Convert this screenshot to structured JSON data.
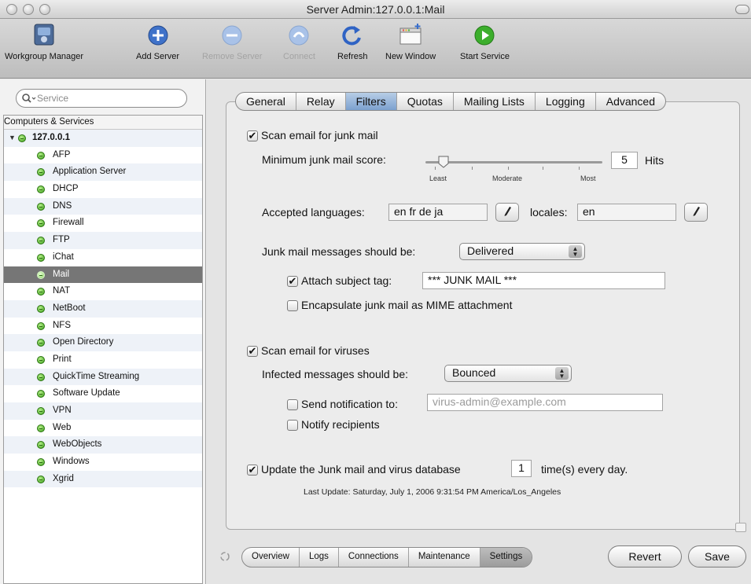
{
  "window": {
    "title": "Server Admin:127.0.0.1:Mail"
  },
  "toolbar": {
    "items": [
      {
        "label": "Workgroup Manager",
        "icon": "workgroup-manager-icon",
        "enabled": true
      },
      {
        "label": "Add Server",
        "icon": "add-server-icon",
        "enabled": true
      },
      {
        "label": "Remove Server",
        "icon": "remove-server-icon",
        "enabled": false
      },
      {
        "label": "Connect",
        "icon": "connect-icon",
        "enabled": false
      },
      {
        "label": "Refresh",
        "icon": "refresh-icon",
        "enabled": true
      },
      {
        "label": "New Window",
        "icon": "new-window-icon",
        "enabled": true
      },
      {
        "label": "Start Service",
        "icon": "start-service-icon",
        "enabled": true
      }
    ]
  },
  "sidebar": {
    "search_placeholder": "Service",
    "header": "Computers & Services",
    "server": "127.0.0.1",
    "services": [
      "AFP",
      "Application Server",
      "DHCP",
      "DNS",
      "Firewall",
      "FTP",
      "iChat",
      "Mail",
      "NAT",
      "NetBoot",
      "NFS",
      "Open Directory",
      "Print",
      "QuickTime Streaming",
      "Software Update",
      "VPN",
      "Web",
      "WebObjects",
      "Windows",
      "Xgrid"
    ],
    "selected": "Mail"
  },
  "tabs": {
    "items": [
      "General",
      "Relay",
      "Filters",
      "Quotas",
      "Mailing Lists",
      "Logging",
      "Advanced"
    ],
    "active": "Filters"
  },
  "filters": {
    "scan_junk_label": "Scan email for junk mail",
    "scan_junk_checked": true,
    "min_score_label": "Minimum junk mail score:",
    "min_score_value": "5",
    "min_score_unit": "Hits",
    "slider_position": 0.1,
    "slider_least": "Least",
    "slider_moderate": "Moderate",
    "slider_most": "Most",
    "accepted_languages_label": "Accepted languages:",
    "accepted_languages_value": "en fr de ja",
    "locales_label": "locales:",
    "locales_value": "en",
    "junk_messages_label": "Junk mail messages should be:",
    "junk_messages_value": "Delivered",
    "attach_subject_label": "Attach subject tag:",
    "attach_subject_checked": true,
    "subject_tag_value": "*** JUNK MAIL ***",
    "encapsulate_label": "Encapsulate junk mail as MIME attachment",
    "encapsulate_checked": false,
    "scan_viruses_label": "Scan email for viruses",
    "scan_viruses_checked": true,
    "infected_label": "Infected messages should be:",
    "infected_value": "Bounced",
    "send_notification_label": "Send notification to:",
    "send_notification_checked": false,
    "notification_placeholder": "virus-admin@example.com",
    "notify_recipients_label": "Notify recipients",
    "notify_recipients_checked": false,
    "update_db_label": "Update the Junk mail and virus database",
    "update_db_checked": true,
    "update_times_value": "1",
    "update_suffix": "time(s) every day.",
    "last_update": "Last Update: Saturday, July 1, 2006 9:31:54 PM America/Los_Angeles"
  },
  "bottom": {
    "segments": [
      "Overview",
      "Logs",
      "Connections",
      "Maintenance",
      "Settings"
    ],
    "active": "Settings",
    "revert_label": "Revert",
    "save_label": "Save"
  },
  "colors": {
    "accent_tab": "#7ca1cf",
    "selected_row": "#767676",
    "service_running": "#3a9d18"
  }
}
